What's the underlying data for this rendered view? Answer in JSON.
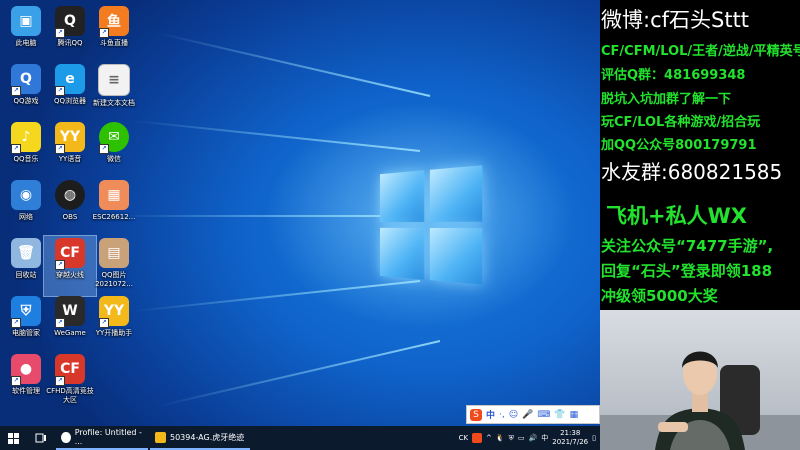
{
  "desktop": {
    "icons": [
      {
        "label": "此电脑",
        "glyph": "▣",
        "bg": "#3aa0e8"
      },
      {
        "label": "腾讯QQ",
        "glyph": "Q",
        "bg": "#222222"
      },
      {
        "label": "斗鱼直播",
        "glyph": "鱼",
        "bg": "#f47c20"
      },
      {
        "label": "QQ游戏",
        "glyph": "Q",
        "bg": "#2f78d8"
      },
      {
        "label": "QQ浏览器",
        "glyph": "e",
        "bg": "#1e9be8"
      },
      {
        "label": "新建文本文档",
        "glyph": "≡",
        "bg": "#f2f2f2"
      },
      {
        "label": "QQ音乐",
        "glyph": "♪",
        "bg": "#f5d81e"
      },
      {
        "label": "YY语音",
        "glyph": "YY",
        "bg": "#f3b81a"
      },
      {
        "label": "微信",
        "glyph": "✉",
        "bg": "#2dc100"
      },
      {
        "label": "网络",
        "glyph": "◉",
        "bg": "#2f7fd8"
      },
      {
        "label": "OBS",
        "glyph": "◍",
        "bg": "#1d1d1d"
      },
      {
        "label": "ESC26612...",
        "glyph": "▦",
        "bg": "#f08c5a"
      },
      {
        "label": "回收站",
        "glyph": "🗑",
        "bg": "#8fb7e0"
      },
      {
        "label": "穿越火线",
        "glyph": "CF",
        "bg": "#d8382a"
      },
      {
        "label": "QQ图片\n2021072...",
        "glyph": "▤",
        "bg": "#c9a27a"
      },
      {
        "label": "电脑管家",
        "glyph": "⛨",
        "bg": "#1f7fe0"
      },
      {
        "label": "WeGame",
        "glyph": "W",
        "bg": "#2a2a2a"
      },
      {
        "label": "YY开播助手",
        "glyph": "YY",
        "bg": "#f3b81a"
      },
      {
        "label": "软件管理",
        "glyph": "●",
        "bg": "#e84a6c"
      },
      {
        "label": "CFHD高清竞技大区",
        "glyph": "CF",
        "bg": "#d8382a"
      }
    ]
  },
  "ime": {
    "label": "中",
    "icons": [
      "·,",
      "☺",
      "🎤",
      "⌨",
      "👕",
      "▦"
    ]
  },
  "taskbar": {
    "tasks": [
      {
        "label": "Profile: Untitled - ..."
      },
      {
        "label": "50394-AG.虎牙绝迹"
      }
    ],
    "tray": {
      "ime_label": "CK",
      "time": "21:38",
      "date": "2021/7/26"
    }
  },
  "stream_panel": {
    "weibo": "微博:cf石头Sttt",
    "games": "CF/CFM/LOL/王者/逆战/平精英号",
    "qgroup": "评估Q群：481699348",
    "line4": "脱坑入坑加群了解一下",
    "line5": "玩CF/LOL各种游戏/招合玩",
    "qq_public": "加QQ公众号800179791",
    "fan_group": "水友群:680821585",
    "wx": "飞机+私人WX",
    "promo1": "关注公众号“7477手游”,",
    "promo2": "回复“石头”登录即领188",
    "promo3": "冲级领5000大奖"
  },
  "colors": {
    "taskbar": "#0c1a2e",
    "green_text": "#22e22e",
    "white_text": "#ffffff",
    "accent": "#0f62c9"
  }
}
